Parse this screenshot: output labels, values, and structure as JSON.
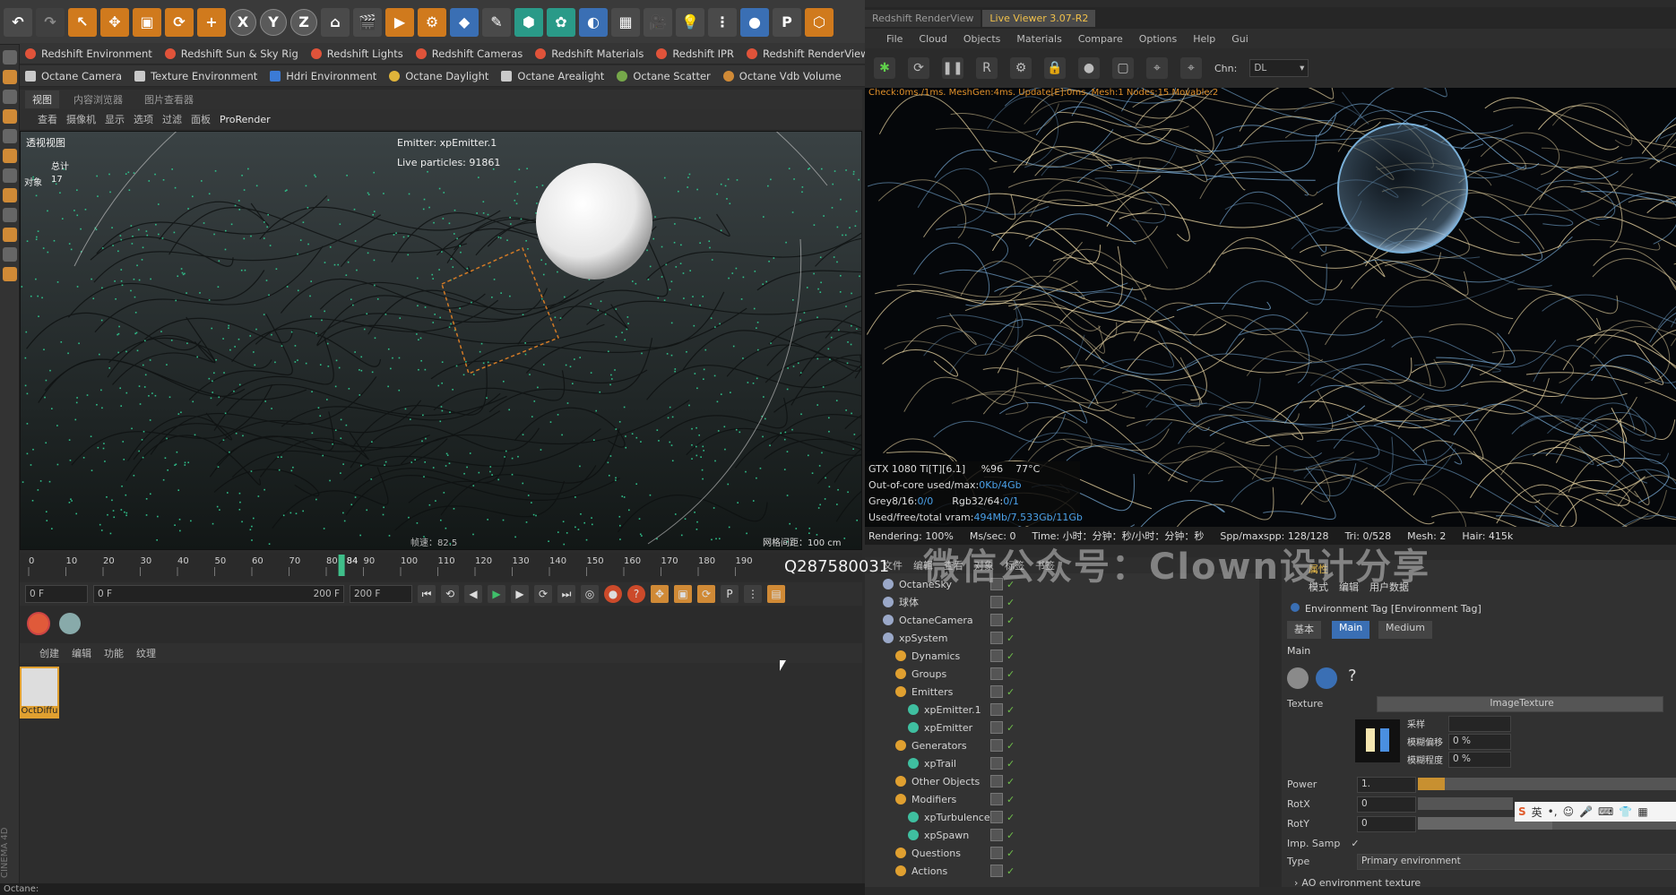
{
  "toolbar": {
    "tools": [
      "undo",
      "move",
      "scale",
      "rotate",
      "add",
      "X",
      "Y",
      "Z",
      "coord",
      "render-view",
      "render",
      "render-settings",
      "cube",
      "pen",
      "subdivision",
      "nurbs",
      "deformer",
      "floor",
      "camera",
      "light",
      "mograph",
      "redshift",
      "PSR"
    ]
  },
  "redshift_bar": [
    "Redshift Environment",
    "Redshift Sun & Sky Rig",
    "Redshift Lights",
    "Redshift Cameras",
    "Redshift Materials",
    "Redshift IPR",
    "Redshift RenderView"
  ],
  "octane_bar": [
    "Octane Camera",
    "Texture Environment",
    "Hdri Environment",
    "Octane Daylight",
    "Octane Arealight",
    "Octane Scatter",
    "Octane Vdb Volume"
  ],
  "viewport": {
    "tabs": [
      "视图",
      "内容浏览器",
      "图片查看器"
    ],
    "menu": [
      "查看",
      "摄像机",
      "显示",
      "选项",
      "过滤",
      "面板",
      "ProRender"
    ],
    "label": "透视视图",
    "stats_total_label": "总计",
    "stats_objects_label": "对象",
    "stats_objects_value": "17",
    "emitter": "Emitter: xpEmitter.1",
    "live_particles": "Live particles: 91861",
    "speed": "帧速：82.5",
    "grid": "网格间距：100 cm"
  },
  "timeline": {
    "ticks": [
      "0",
      "10",
      "20",
      "30",
      "40",
      "50",
      "60",
      "70",
      "80",
      "90",
      "100",
      "110",
      "120",
      "130",
      "140",
      "150",
      "160",
      "170",
      "180",
      "190"
    ],
    "current": "84",
    "start_field": "0 F",
    "range_start": "0 F",
    "range_end": "200 F",
    "end_field": "200 F"
  },
  "materials": {
    "menu": [
      "创建",
      "编辑",
      "功能",
      "纹理"
    ],
    "item_label": "OctDiffu"
  },
  "status": "Octane:",
  "renderer": {
    "tabs": [
      "Redshift RenderView",
      "Live Viewer 3.07-R2"
    ],
    "menu": [
      "File",
      "Cloud",
      "Objects",
      "Materials",
      "Compare",
      "Options",
      "Help",
      "Gui"
    ],
    "channel_label": "Chn:",
    "channel_value": "DL",
    "check_line": "Check:0ms./1ms. MeshGen:4ms. Update[E]:0ms. Mesh:1 Nodes:15 Movable:2",
    "gpu": "GTX 1080 Ti[T][6.1]",
    "gpu_pct": "%96",
    "gpu_temp": "77°C",
    "out_of_core": "Out-of-core used/max:",
    "out_of_core_val": "0Kb/4Gb",
    "grey": "Grey8/16:",
    "grey_val": "0/0",
    "rgb": "Rgb32/64:",
    "rgb_val": "0/1",
    "vram": "Used/free/total vram:",
    "vram_val": "494Mb/7.533Gb/11Gb",
    "rendering": "Rendering: 100%",
    "ms": "Ms/sec: 0",
    "time": "Time: 小时：分钟：秒/小时：分钟：秒",
    "spp": "Spp/maxspp: 128/128",
    "tri": "Tri: 0/528",
    "mesh": "Mesh: 2",
    "hair": "Hair: 415k"
  },
  "watermark": "微信公众号：Clown设计分享",
  "qq": "Q287580031",
  "object_manager": {
    "menu": [
      "文件",
      "编辑",
      "查看",
      "对象",
      "标签",
      "书签"
    ],
    "items": [
      {
        "name": "OctaneSky",
        "indent": 0
      },
      {
        "name": "球体",
        "indent": 0
      },
      {
        "name": "OctaneCamera",
        "indent": 0
      },
      {
        "name": "xpSystem",
        "indent": 0
      },
      {
        "name": "Dynamics",
        "indent": 1
      },
      {
        "name": "Groups",
        "indent": 1
      },
      {
        "name": "Emitters",
        "indent": 1
      },
      {
        "name": "xpEmitter.1",
        "indent": 2
      },
      {
        "name": "xpEmitter",
        "indent": 2
      },
      {
        "name": "Generators",
        "indent": 1
      },
      {
        "name": "xpTrail",
        "indent": 2
      },
      {
        "name": "Other Objects",
        "indent": 1
      },
      {
        "name": "Modifiers",
        "indent": 1
      },
      {
        "name": "xpTurbulence",
        "indent": 2
      },
      {
        "name": "xpSpawn",
        "indent": 2
      },
      {
        "name": "Questions",
        "indent": 1
      },
      {
        "name": "Actions",
        "indent": 1
      }
    ]
  },
  "attribute_manager": {
    "header": "属性",
    "menu": [
      "模式",
      "编辑",
      "用户数据"
    ],
    "title": "Environment Tag [Environment Tag]",
    "tabs": [
      "基本",
      "Main",
      "Medium"
    ],
    "section": "Main",
    "texture_label": "Texture",
    "texture_value": "ImageTexture",
    "sample_label": "采样",
    "blur_offset_label": "模糊偏移",
    "blur_offset_value": "0 %",
    "blur_degree_label": "模糊程度",
    "blur_degree_value": "0 %",
    "power_label": "Power",
    "power_value": "1.",
    "rotx_label": "RotX",
    "rotx_value": "0",
    "roty_label": "RotY",
    "roty_value": "0",
    "imp_label": "Imp. Samp",
    "type_label": "Type",
    "type_value": "Primary environment",
    "ao_label": "AO environment texture"
  },
  "ime": {
    "lang": "英"
  }
}
